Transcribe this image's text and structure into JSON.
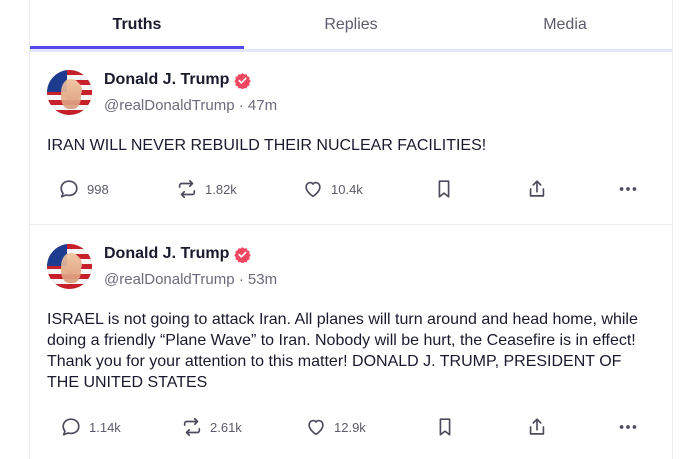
{
  "tabs": [
    {
      "label": "Truths",
      "active": true
    },
    {
      "label": "Replies",
      "active": false
    },
    {
      "label": "Media",
      "active": false
    }
  ],
  "colors": {
    "accent": "#5448ee",
    "verified": "#f0465f"
  },
  "posts": [
    {
      "author": "Donald J. Trump",
      "handle": "@realDonaldTrump",
      "time": "47m",
      "handle_time": "@realDonaldTrump · 47m",
      "text": "IRAN WILL NEVER REBUILD THEIR NUCLEAR FACILITIES!",
      "replies": "998",
      "retruths": "1.82k",
      "likes": "10.4k"
    },
    {
      "author": "Donald J. Trump",
      "handle": "@realDonaldTrump",
      "time": "53m",
      "handle_time": "@realDonaldTrump · 53m",
      "text": "ISRAEL is not going to attack Iran. All planes will turn around and head home, while doing a friendly “Plane Wave” to Iran. Nobody will be hurt, the Ceasefire is in effect! Thank you for your attention to this matter! DONALD J. TRUMP, PRESIDENT OF THE UNITED STATES",
      "replies": "1.14k",
      "retruths": "2.61k",
      "likes": "12.9k"
    }
  ],
  "icons": {
    "reply": "speech-bubble-icon",
    "retruth": "repost-arrows-icon",
    "like": "heart-icon",
    "bookmark": "bookmark-icon",
    "share": "share-upload-icon",
    "more": "more-dots-icon",
    "verified": "verified-badge-icon"
  }
}
